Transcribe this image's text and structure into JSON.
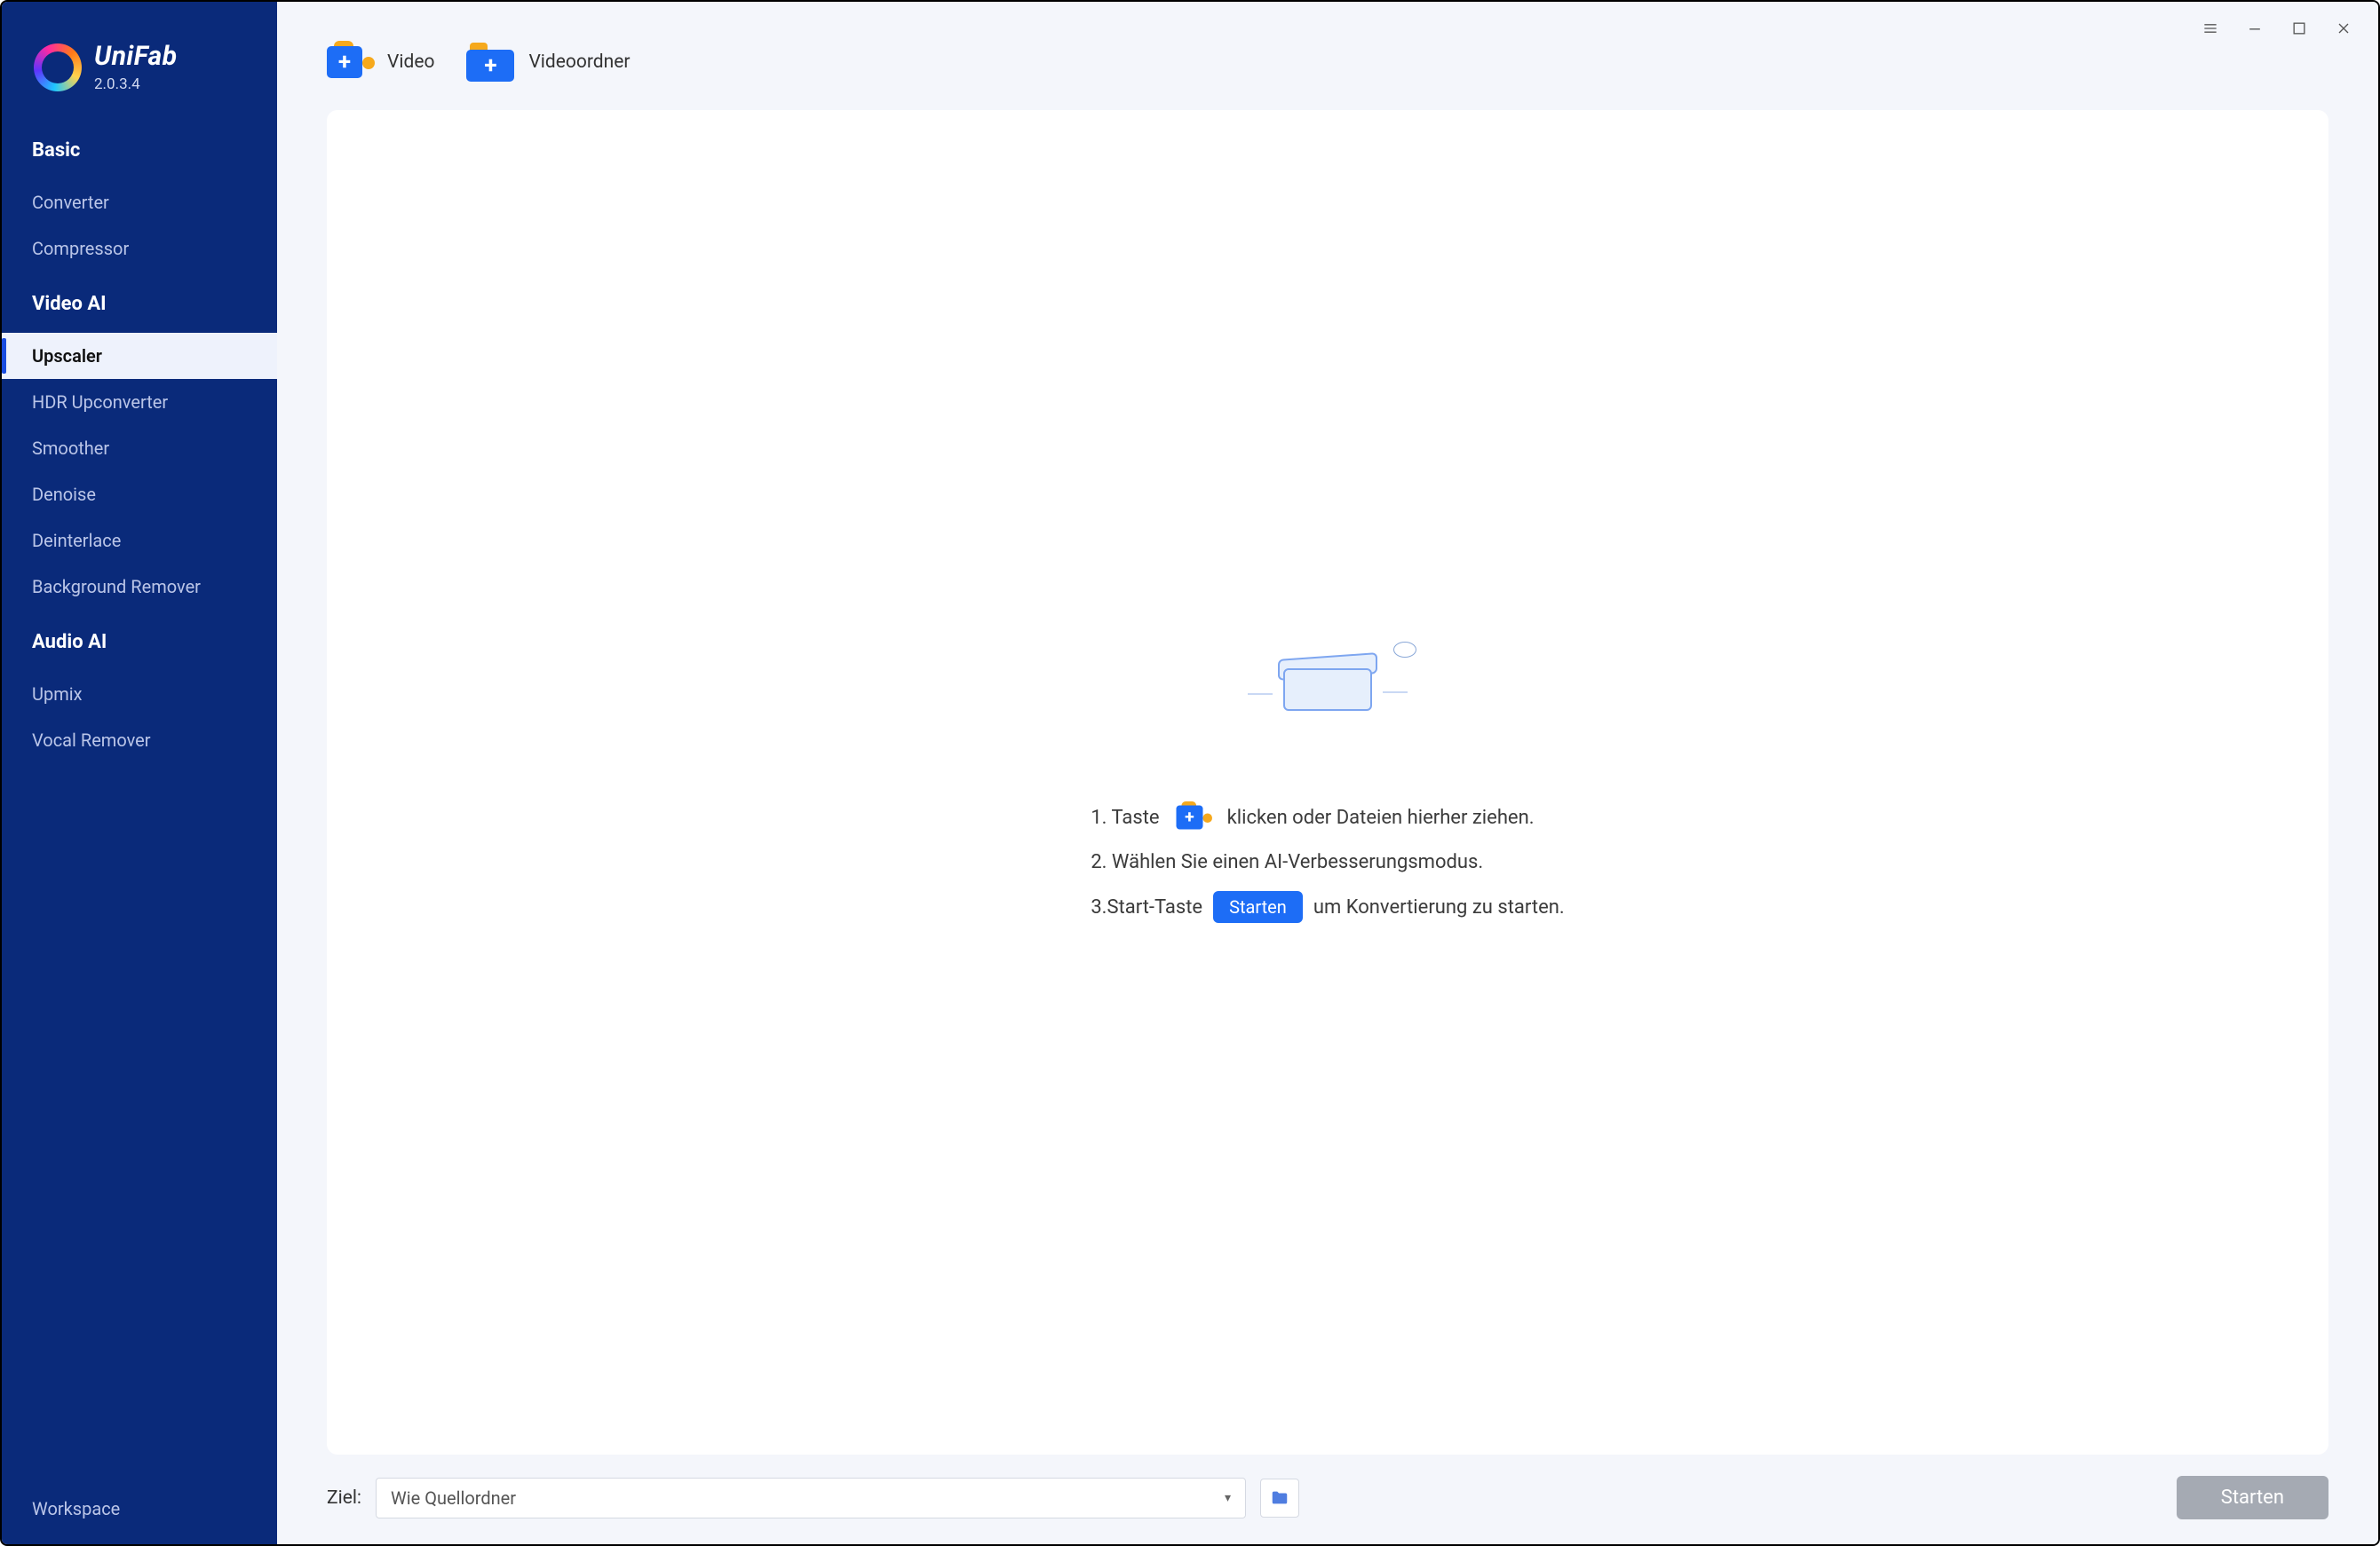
{
  "app": {
    "name": "UniFab",
    "version": "2.0.3.4"
  },
  "sidebar": {
    "sections": [
      {
        "title": "Basic",
        "items": [
          "Converter",
          "Compressor"
        ]
      },
      {
        "title": "Video AI",
        "items": [
          "Upscaler",
          "HDR Upconverter",
          "Smoother",
          "Denoise",
          "Deinterlace",
          "Background Remover"
        ]
      },
      {
        "title": "Audio AI",
        "items": [
          "Upmix",
          "Vocal Remover"
        ]
      }
    ],
    "active": "Upscaler",
    "workspace": "Workspace"
  },
  "toolbar": {
    "add_video": "Video",
    "add_folder": "Videoordner"
  },
  "instructions": {
    "step1_a": "1. Taste",
    "step1_b": "klicken oder Dateien hierher ziehen.",
    "step2": "2. Wählen Sie einen AI-Verbesserungsmodus.",
    "step3_a": "3.Start-Taste",
    "step3_btn": "Starten",
    "step3_b": "um Konvertierung zu starten."
  },
  "footer": {
    "dest_label": "Ziel:",
    "dest_value": "Wie Quellordner",
    "start_button": "Starten"
  }
}
